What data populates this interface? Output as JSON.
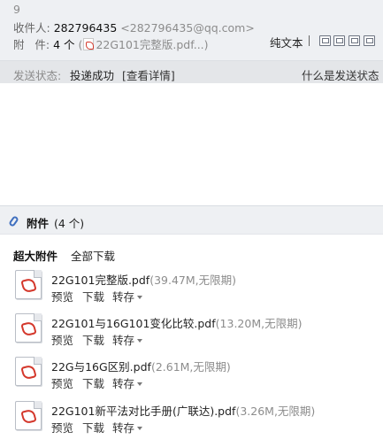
{
  "header": {
    "top_text": "9",
    "sender_label": "收件人:",
    "sender_name": "282796435",
    "sender_email": "<282796435@qq.com>",
    "attach_label": "附   件:",
    "attach_count": "4 个",
    "attach_open": "(",
    "attach_file": "22G101完整版.pdf...",
    "attach_close": ")",
    "plain_text": "纯文本"
  },
  "status": {
    "label": "发送状态:",
    "value": "投递成功",
    "detail_link": "[查看详情]",
    "right_text": "什么是发送状态"
  },
  "attachments_section": {
    "title": "附件",
    "count": "(4 个)",
    "big_attach_label": "超大附件",
    "download_all": "全部下载",
    "actions": {
      "preview": "预览",
      "download": "下载",
      "save": "转存"
    },
    "items": [
      {
        "name": "22G101完整版.pdf",
        "size": "(39.47M,无限期)",
        "icon": "pdf-file-icon"
      },
      {
        "name": "22G101与16G101变化比较.pdf",
        "size": "(13.20M,无限期)",
        "icon": "pdf-file-icon"
      },
      {
        "name": "22G与16G区别.pdf",
        "size": "(2.61M,无限期)",
        "icon": "pdf-file-icon"
      },
      {
        "name": "22G101新平法对比手册(广联达).pdf",
        "size": "(3.26M,无限期)",
        "icon": "pdf-file-icon"
      }
    ]
  }
}
